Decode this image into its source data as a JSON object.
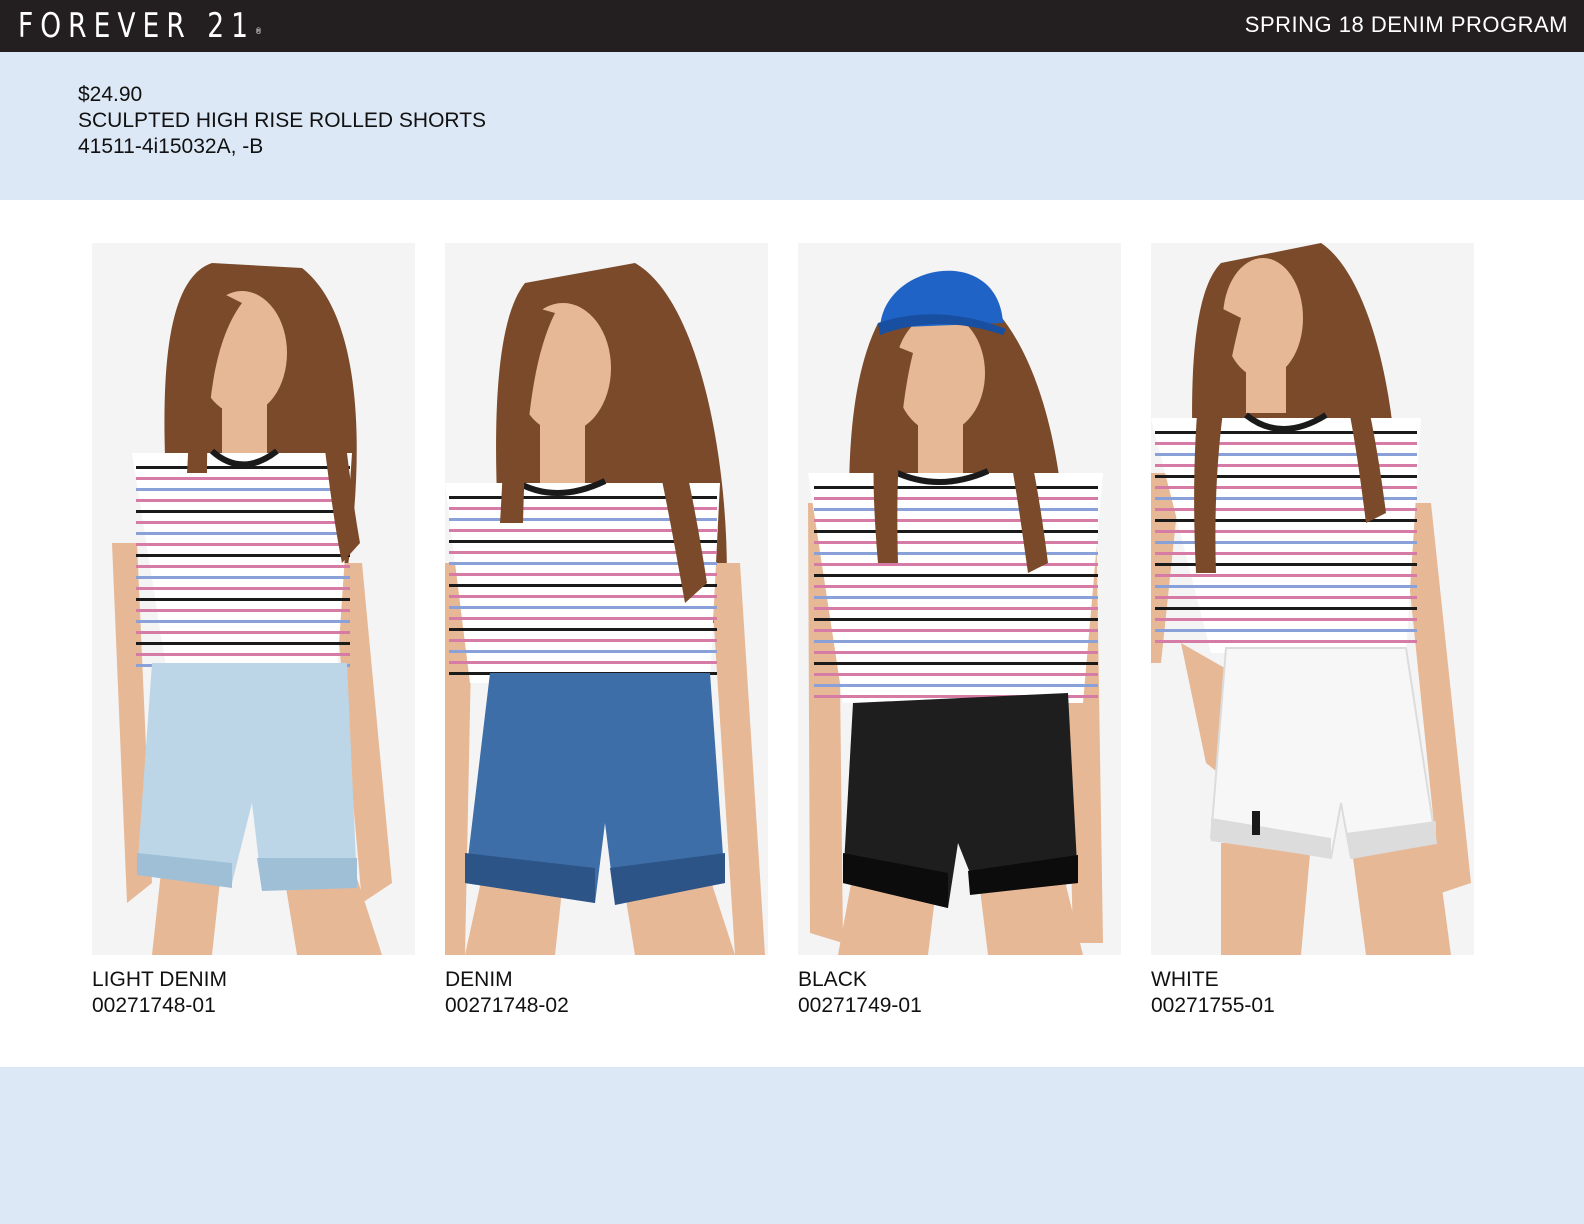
{
  "header": {
    "brand": "FOREVER 21",
    "brand_mark": "®",
    "program_title": "SPRING 18 DENIM PROGRAM"
  },
  "product": {
    "price": "$24.90",
    "name": "SCULPTED HIGH RISE ROLLED SHORTS",
    "style_numbers": "41511-4i15032A, -B"
  },
  "variants": [
    {
      "color_name": "LIGHT DENIM",
      "sku": "00271748-01",
      "short_color": "#bcd6e8",
      "short_shade": "#9fbfd6",
      "photo": "model in striped tee and light denim shorts"
    },
    {
      "color_name": "DENIM",
      "sku": "00271748-02",
      "short_color": "#3d6ea8",
      "short_shade": "#2c5487",
      "photo": "model in striped tee and denim shorts"
    },
    {
      "color_name": "BLACK",
      "sku": "00271749-01",
      "short_color": "#1e1e1e",
      "short_shade": "#0c0c0c",
      "photo": "model in blue cap, striped tee and black shorts"
    },
    {
      "color_name": "WHITE",
      "sku": "00271755-01",
      "short_color": "#f7f7f7",
      "short_shade": "#dcdcdc",
      "photo": "model in striped tee and white shorts"
    }
  ],
  "colors": {
    "header_bg": "#231f20",
    "band_bg": "#dde8f6",
    "hair": "#7a4a2a",
    "skin": "#e6b896",
    "cap": "#1f63c6",
    "stripe_pink": "#d67aa6",
    "stripe_black": "#1a1a1a",
    "stripe_blue": "#8aa0d8"
  }
}
